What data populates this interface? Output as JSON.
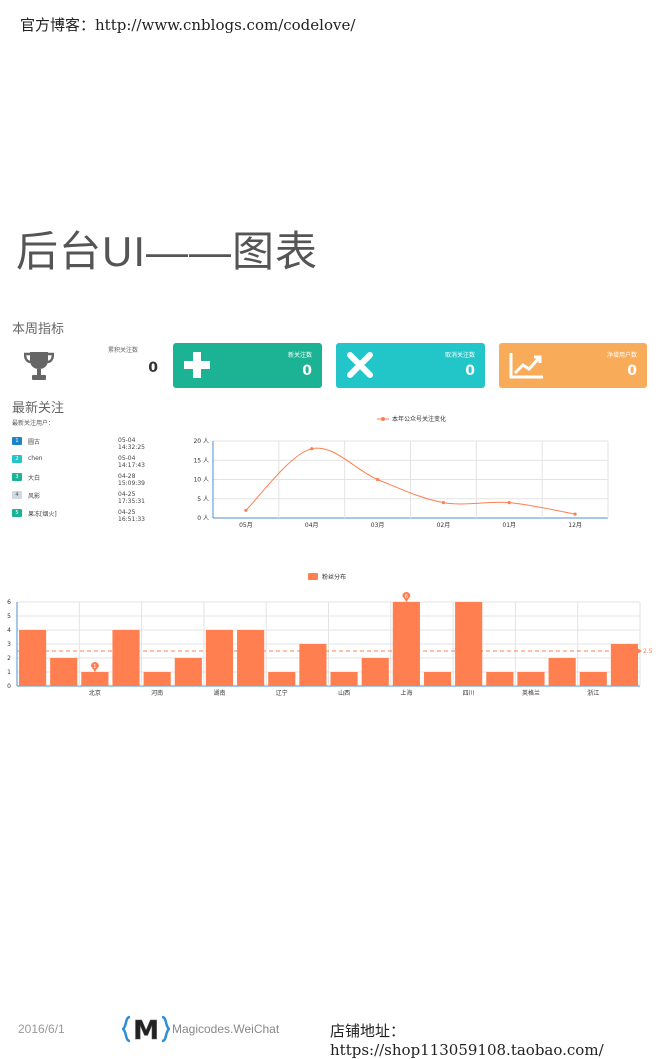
{
  "header": {
    "blog_text": "官方博客：http://www.cnblogs.com/codelove/",
    "title": "后台UI——图表"
  },
  "week_section": {
    "title": "本周指标",
    "trophy_icon": "trophy-icon",
    "plain_kpi": {
      "label": "累积关注数",
      "value": "0"
    },
    "cards": [
      {
        "label": "新关注数",
        "value": "0",
        "color": "#1cb394",
        "icon": "plus-icon"
      },
      {
        "label": "取消关注数",
        "value": "0",
        "color": "#23c6c8",
        "icon": "close-icon"
      },
      {
        "label": "净增用户数",
        "value": "0",
        "color": "#f8ac59",
        "icon": "trend-chart-icon"
      }
    ]
  },
  "latest_section": {
    "title": "最新关注",
    "subtitle": "最新关注用户：",
    "rows": [
      {
        "rank": "1",
        "name": "圆古",
        "time": "05-04 14:32:25",
        "color": "#1c84c6"
      },
      {
        "rank": "2",
        "name": "chen",
        "time": "05-04 14:17:43",
        "color": "#23c6c8"
      },
      {
        "rank": "3",
        "name": "大白",
        "time": "04-28 15:09:39",
        "color": "#1cb394"
      },
      {
        "rank": "4",
        "name": "风影",
        "time": "04-25 17:35:31",
        "color": "#d1dade"
      },
      {
        "rank": "5",
        "name": "果冻[烟火]",
        "time": "04-25 16:51:33",
        "color": "#1cb394"
      }
    ]
  },
  "chart_data": [
    {
      "type": "line",
      "legend": "本年公众号关注变化",
      "categories": [
        "05月",
        "04月",
        "03月",
        "02月",
        "01月",
        "12月"
      ],
      "series": [
        {
          "name": "本年公众号关注变化",
          "values": [
            2,
            18,
            10,
            4,
            4,
            1
          ]
        }
      ],
      "y_ticks": [
        "0 人",
        "5 人",
        "10 人",
        "15 人",
        "20 人"
      ],
      "ylim": [
        0,
        20
      ],
      "grid": true,
      "color": "#ff7f50"
    },
    {
      "type": "bar",
      "legend": "粉丝分布",
      "categories": [
        "",
        "",
        "北京",
        "",
        "河南",
        "",
        "湖南",
        "",
        "辽宁",
        "",
        "山西",
        "",
        "上海",
        "",
        "四川",
        "",
        "英格兰",
        "",
        "浙江",
        ""
      ],
      "series": [
        {
          "name": "粉丝分布",
          "values": [
            4,
            2,
            1,
            4,
            1,
            2,
            4,
            4,
            1,
            3,
            1,
            2,
            6,
            1,
            6,
            1,
            1,
            2,
            1,
            3
          ]
        }
      ],
      "y_ticks": [
        "0",
        "1",
        "2",
        "3",
        "4",
        "5",
        "6"
      ],
      "ylim": [
        0,
        6
      ],
      "mark_min": {
        "label": "1",
        "index": 2
      },
      "mark_max": {
        "label": "6",
        "index": 12
      },
      "average": 2.5,
      "average_label": "2.5",
      "color": "#ff7f50"
    }
  ],
  "footer": {
    "date": "2016/6/1",
    "brand": "Magicodes.WeiChat",
    "shop": "店铺地址：https://shop113059108.taobao.com/",
    "logo_letter": "M"
  }
}
